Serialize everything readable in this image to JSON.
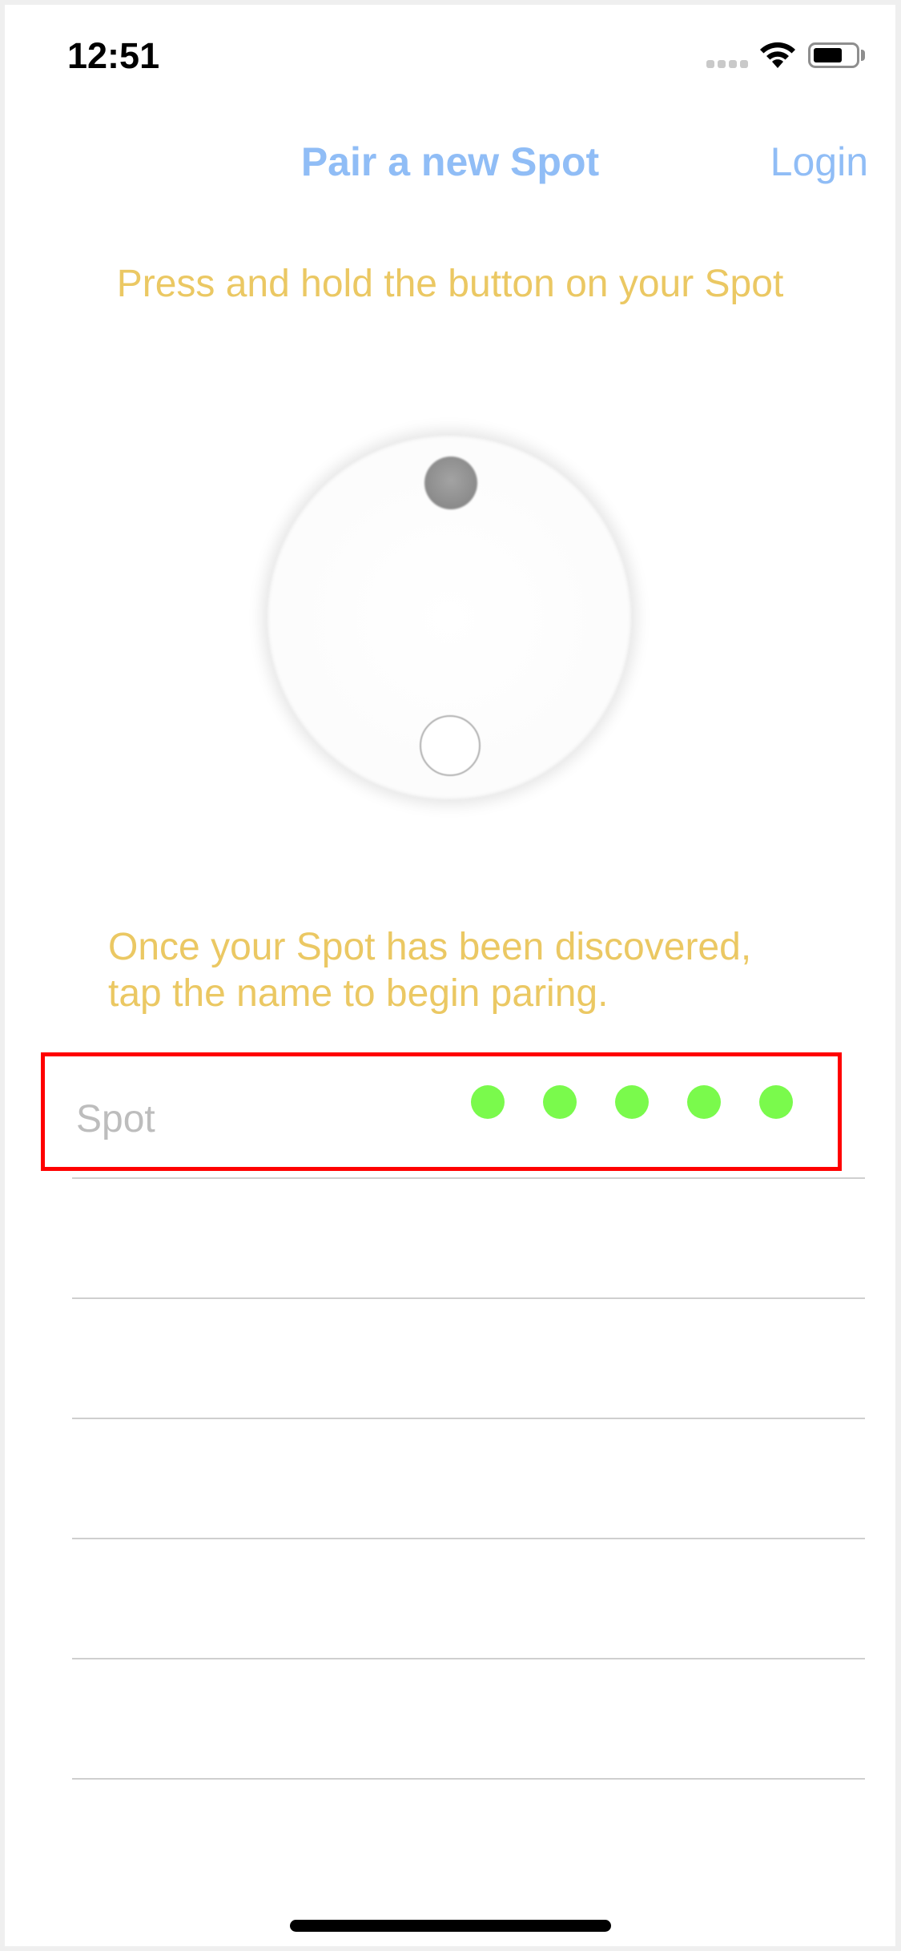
{
  "status_bar": {
    "time": "12:51",
    "signal_icon": "cellular-signal-icon",
    "wifi_icon": "wifi-icon",
    "battery_icon": "battery-icon",
    "battery_level": 0.6
  },
  "nav": {
    "title": "Pair a new Spot",
    "login_label": "Login"
  },
  "instructions": {
    "press_hold": "Press and hold the button on your Spot",
    "discovered_line1": "Once your Spot has been discovered,",
    "discovered_line2": "tap the name to begin paring."
  },
  "device_illustration": {
    "name": "spot-device-icon",
    "led": "led-indicator-icon",
    "button": "device-button-icon"
  },
  "discovered_devices": [
    {
      "name": "Spot",
      "signal_strength_dots": 5,
      "signal_total_dots": 5
    }
  ],
  "empty_rows": 5,
  "colors": {
    "nav_accent": "#90bdf6",
    "instruction_text": "#ebc863",
    "device_name": "#bdbdbd",
    "signal_dot": "#7afa4c",
    "highlight_border": "#ff0000"
  }
}
